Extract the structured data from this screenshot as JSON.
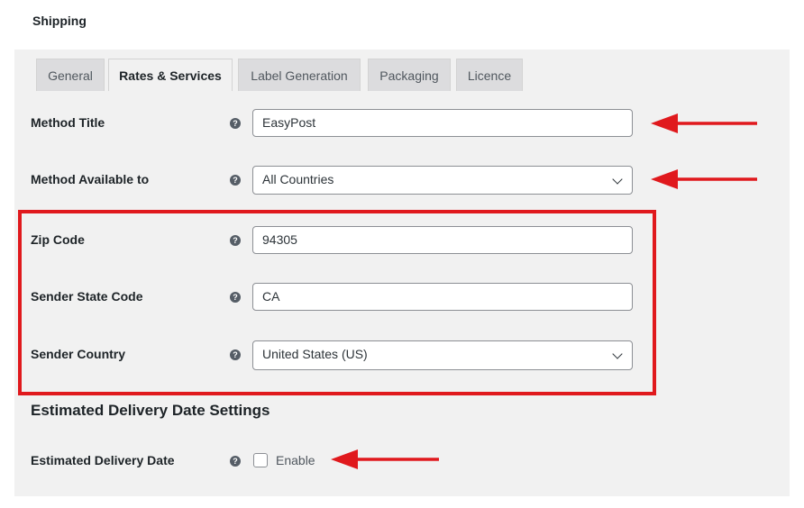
{
  "page": {
    "title": "Shipping"
  },
  "tabs": [
    {
      "label": "General",
      "active": false
    },
    {
      "label": "Rates & Services",
      "active": true
    },
    {
      "label": "Label Generation",
      "active": false
    },
    {
      "label": "Packaging",
      "active": false
    },
    {
      "label": "Licence",
      "active": false
    }
  ],
  "form": {
    "method_title": {
      "label": "Method Title",
      "value": "EasyPost"
    },
    "method_available": {
      "label": "Method Available to",
      "value": "All Countries"
    },
    "zip_code": {
      "label": "Zip Code",
      "value": "94305"
    },
    "sender_state": {
      "label": "Sender State Code",
      "value": "CA"
    },
    "sender_country": {
      "label": "Sender Country",
      "value": "United States (US)"
    }
  },
  "delivery": {
    "section_title": "Estimated Delivery Date Settings",
    "label": "Estimated Delivery Date",
    "checkbox_label": "Enable",
    "checked": false
  },
  "icons": {
    "help": "question-icon",
    "dropdown": "chevron-down-icon",
    "annotation": "arrow-left-icon"
  },
  "colors": {
    "annotation": "#e0191d",
    "panel": "#f1f1f1"
  }
}
